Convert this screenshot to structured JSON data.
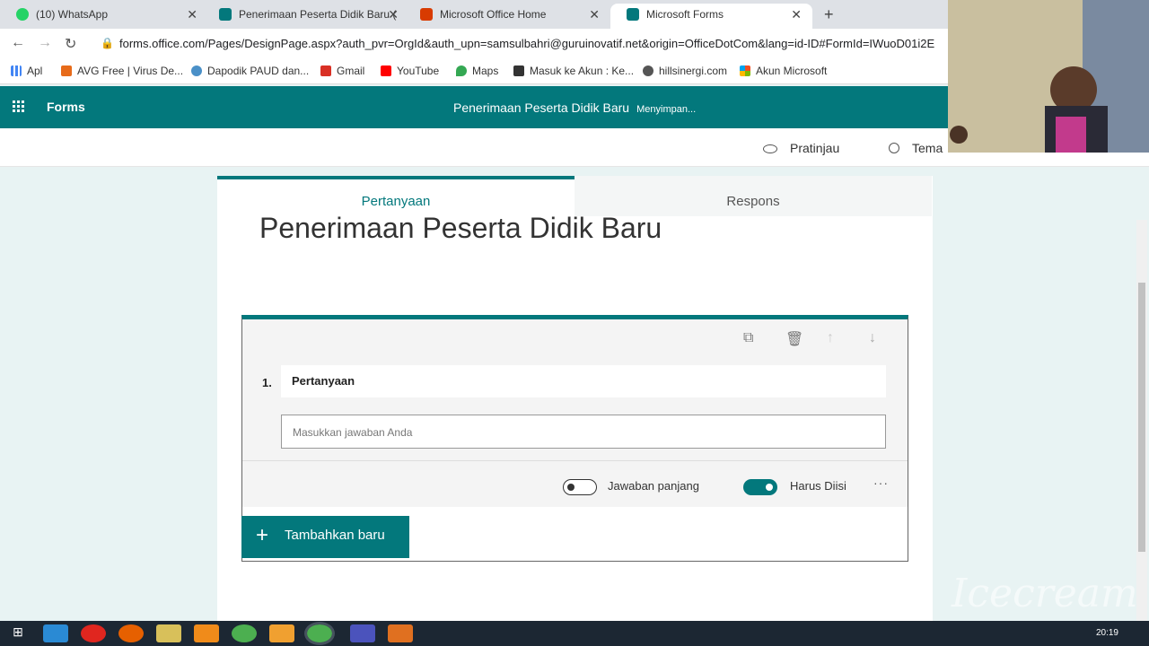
{
  "title": "Microsoft Forms – Penerimaan Peserta Didik Baru",
  "tabs": [
    "(10) WhatsApp",
    "Penerimaan Peserta Didik Baru (",
    "Microsoft Office Home",
    "Microsoft Forms"
  ],
  "url": "forms.office.com/Pages/DesignPage.aspx?auth_pvr=OrgId&auth_upn=samsulbahri@guruinovatif.net&origin=OfficeDotCom&lang=id-ID#FormId=IWuoD01i2E",
  "bookmarks": [
    "Apl",
    "AVG Free | Virus De...",
    "Dapodik PAUD dan...",
    "Gmail",
    "YouTube",
    "Maps",
    "Masuk ke Akun : Ke...",
    "hillsinergi.com",
    "Akun Microsoft"
  ],
  "form_title": "Penerimaan Peserta Didik Baru",
  "form_tabs": [
    "Pertanyaan",
    "Respons"
  ],
  "question_number": "1.",
  "question_placeholder": "Pertanyaan",
  "answer_placeholder": "Masukkan jawaban Anda",
  "options": [
    "Jawaban panjang",
    "Harus Diisi"
  ],
  "add_new": "Tambahkan baru",
  "header_actions": [
    "Pratinjau",
    "Tema"
  ],
  "clock": "20:19",
  "appbar": {
    "brand": "Forms",
    "saving": "Menyimpan..."
  },
  "colors": {
    "accent": "#03787c"
  },
  "icons": [
    "whatsapp-icon",
    "forms-icon",
    "office-icon",
    "back-icon",
    "forward-icon",
    "reload-icon",
    "lock-icon",
    "apps-icon",
    "eye-icon",
    "palette-icon",
    "copy-icon",
    "trash-icon",
    "arrow-up-icon",
    "arrow-down-icon",
    "plus-icon",
    "more-icon",
    "windows-start-icon"
  ]
}
